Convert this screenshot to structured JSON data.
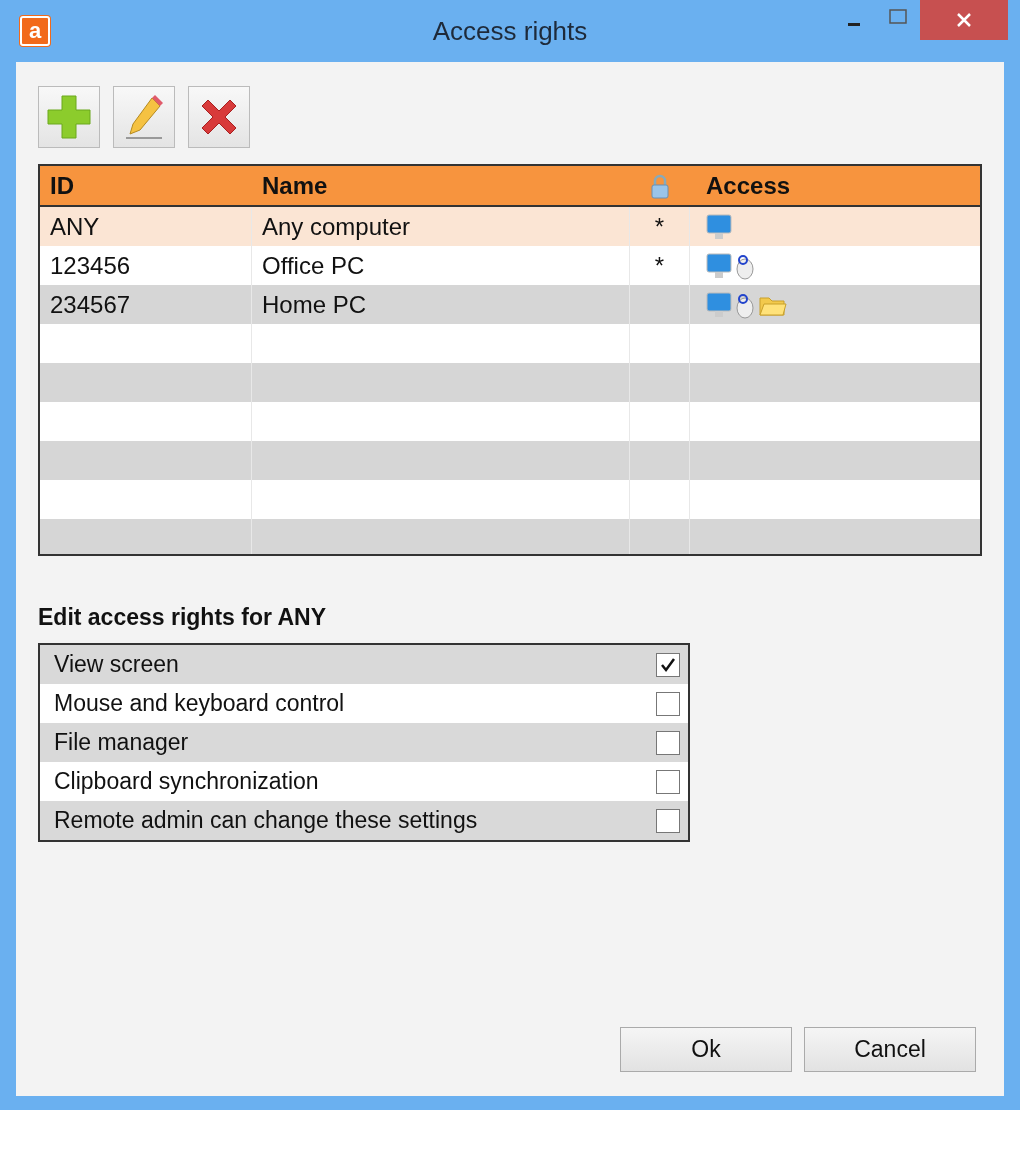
{
  "window": {
    "logo": "a",
    "title": "Access rights"
  },
  "toolbar": [
    {
      "kind": "add"
    },
    {
      "kind": "edit"
    },
    {
      "kind": "delete"
    }
  ],
  "table": {
    "columns": [
      {
        "kind": "text",
        "label": "ID"
      },
      {
        "kind": "text",
        "label": "Name"
      },
      {
        "kind": "lock"
      },
      {
        "kind": "text",
        "label": "Access"
      }
    ],
    "rows": [
      {
        "id": "ANY",
        "name": "Any computer",
        "mark": "*",
        "access": [
          {
            "kind": "screen"
          }
        ],
        "selected": true
      },
      {
        "id": "123456",
        "name": "Office PC",
        "mark": "*",
        "access": [
          {
            "kind": "screen"
          },
          {
            "kind": "mouse"
          }
        ],
        "selected": false
      },
      {
        "id": "234567",
        "name": "Home PC",
        "access": [
          {
            "kind": "screen"
          },
          {
            "kind": "mouse"
          },
          {
            "kind": "folder"
          }
        ],
        "selected": false
      }
    ]
  },
  "edit": {
    "heading": "Edit access rights for ANY",
    "options": [
      {
        "label": "View screen",
        "checked": true
      },
      {
        "label": "Mouse and keyboard control",
        "checked": false
      },
      {
        "label": "File manager",
        "checked": false
      },
      {
        "label": "Clipboard synchronization",
        "checked": false
      },
      {
        "label": "Remote admin can change these settings",
        "checked": false
      }
    ]
  },
  "buttons": [
    "Ok",
    "Cancel"
  ]
}
